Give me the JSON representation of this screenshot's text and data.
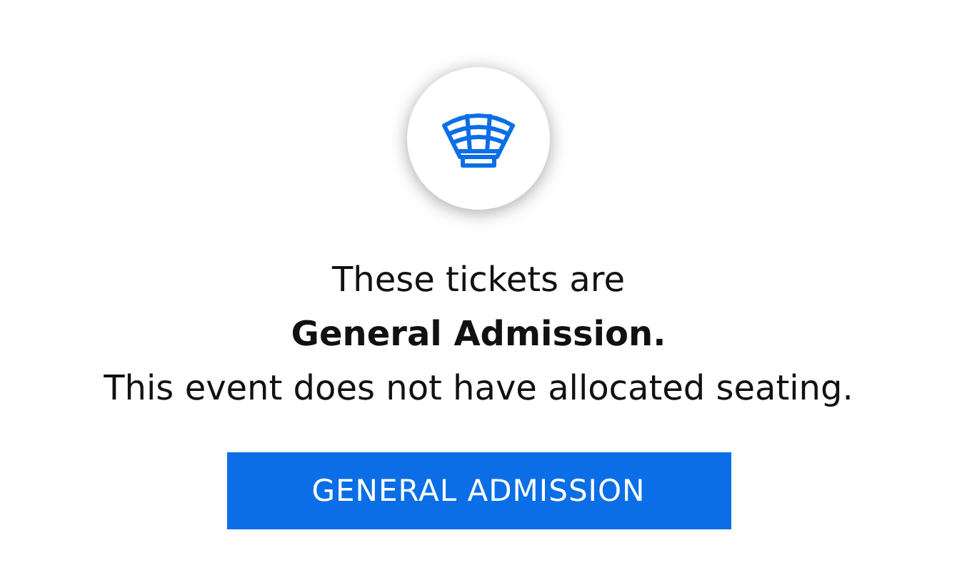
{
  "message": "These tickets are\n**General Admission.**\nThis event does not have allocated seating.",
  "button": "GENERAL ADMISSION"
}
